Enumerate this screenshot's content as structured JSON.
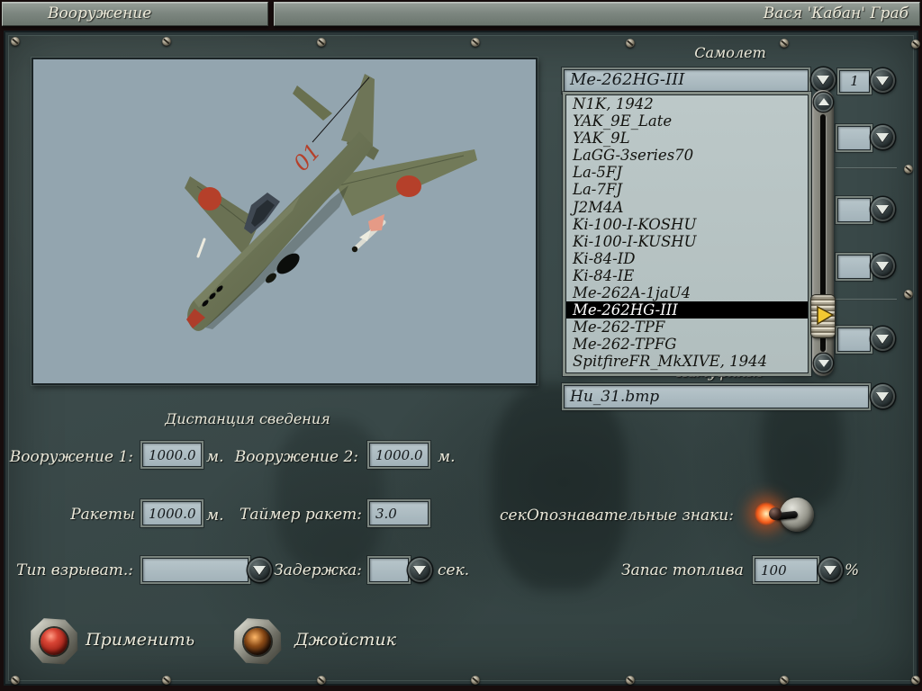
{
  "titlebar": {
    "screen_title": "Вооружение",
    "pilot_name": "Вася 'Кабан' Граб"
  },
  "aircraft_section": {
    "label": "Самолет",
    "selected_aircraft": "Me-262HG-III",
    "count_value": "1",
    "selected_index": 12,
    "aircraft_list": [
      "N1K, 1942",
      "YAK_9E_Late",
      "YAK_9L",
      "LaGG-3series70",
      "La-5FJ",
      "La-7FJ",
      "J2M4A",
      "Ki-100-I-KOSHU",
      "Ki-100-I-KUSHU",
      "Ki-84-ID",
      "Ki-84-IE",
      "Me-262A-1jaU4",
      "Me-262HG-III",
      "Me-262-TPF",
      "Me-262-TPFG",
      "SpitfireFR_MkXIVE, 1944"
    ]
  },
  "skin_section": {
    "occluded_label": "Камуфляж",
    "skin_value": "Hu_31.bmp"
  },
  "weapons_panel": {
    "title": "Дистанция сведения",
    "weapon1": {
      "label": "Вооружение 1:",
      "value": "1000.0",
      "unit": "м."
    },
    "weapon2": {
      "label": "Вооружение 2:",
      "value": "1000.0",
      "unit": "м."
    },
    "rockets": {
      "label": "Ракеты",
      "value": "1000.0",
      "unit": "м."
    },
    "rocket_timer": {
      "label": "Таймер ракет:",
      "value": "3.0",
      "unit": "сек"
    },
    "markings": {
      "label": "Опознавательные знаки:"
    },
    "fuse_type": {
      "label": "Тип взрыват.:",
      "value": ""
    },
    "delay": {
      "label": "Задержка:",
      "value": "",
      "unit": "сек."
    },
    "fuel": {
      "label": "Запас топлива",
      "value": "100",
      "unit": "%"
    }
  },
  "actions": {
    "apply": "Применить",
    "joystick": "Джойстик"
  },
  "colors": {
    "panel": "#3c4a4d",
    "field_bg": "#adbdc3",
    "list_bg": "#b9c5c5",
    "selected_bg": "#000000",
    "selected_text": "#ffffff",
    "label_text": "#eae8d9",
    "accent_red": "#b5402a",
    "glow_orange": "#ff7020",
    "preview_bg": "#93a5af"
  }
}
